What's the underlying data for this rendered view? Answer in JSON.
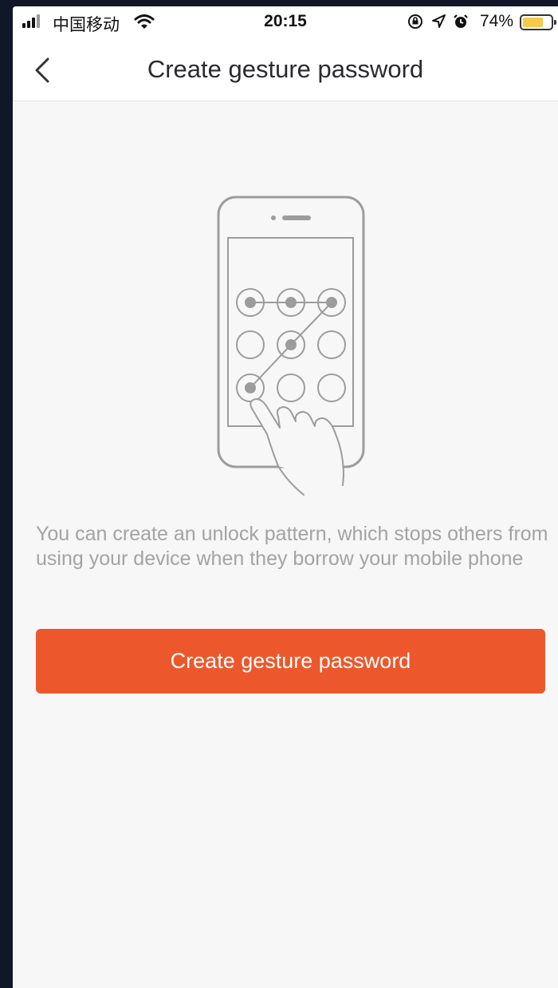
{
  "status_bar": {
    "carrier": "中国移动",
    "time": "20:15",
    "battery_pct": "74%",
    "battery_level": 0.74,
    "icons": [
      "signal-icon",
      "wifi-icon",
      "rotation-lock-icon",
      "location-arrow-icon",
      "alarm-icon",
      "battery-icon"
    ]
  },
  "nav": {
    "back_icon": "chevron-left-icon",
    "title": "Create gesture password"
  },
  "illustration": {
    "icon": "phone-pattern-lock-icon"
  },
  "main": {
    "description": "You can create an unlock pattern, which stops others from using your device when they borrow your mobile phone",
    "button_label": "Create gesture password"
  },
  "colors": {
    "accent": "#ec582c",
    "background": "#f7f7f7",
    "description_text": "#a3a3a3",
    "title_text": "#2a2a2e"
  }
}
